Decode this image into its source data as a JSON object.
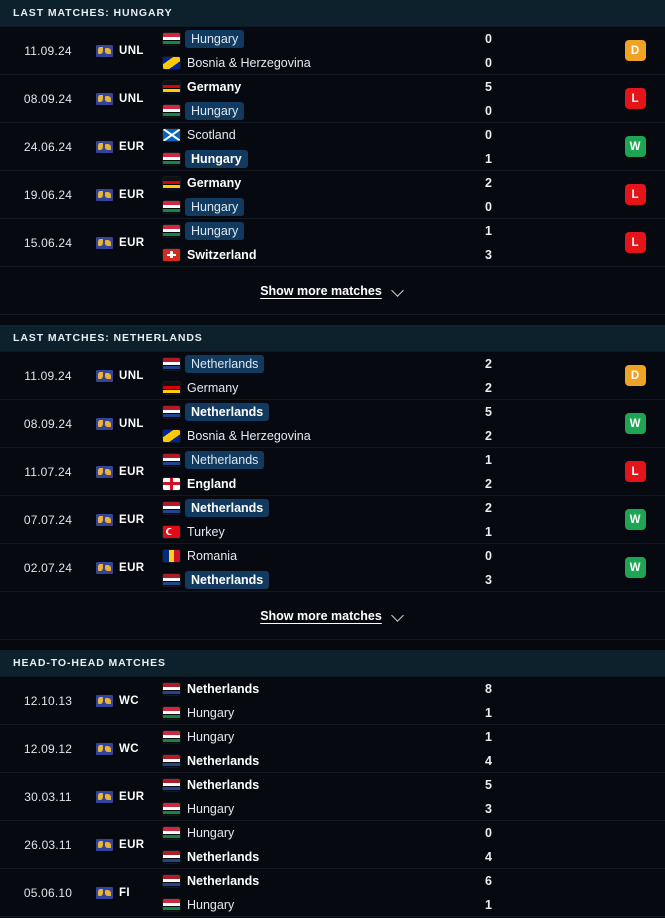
{
  "sections": [
    {
      "id": "last-matches-hungary",
      "title": "LAST MATCHES: HUNGARY",
      "show_more_label": "Show more matches",
      "matches": [
        {
          "date": "11.09.24",
          "competition": "UNL",
          "competition_icon": "globe-icon",
          "home": {
            "team": "Hungary",
            "flag": "hungary",
            "score": "0",
            "winner": false,
            "highlight": true
          },
          "away": {
            "team": "Bosnia & Herzegovina",
            "flag": "bosnia",
            "score": "0",
            "winner": false,
            "highlight": false
          },
          "result": "D"
        },
        {
          "date": "08.09.24",
          "competition": "UNL",
          "competition_icon": "globe-icon",
          "home": {
            "team": "Germany",
            "flag": "germany",
            "score": "5",
            "winner": true,
            "highlight": false
          },
          "away": {
            "team": "Hungary",
            "flag": "hungary",
            "score": "0",
            "winner": false,
            "highlight": true
          },
          "result": "L"
        },
        {
          "date": "24.06.24",
          "competition": "EUR",
          "competition_icon": "globe-icon",
          "home": {
            "team": "Scotland",
            "flag": "scotland",
            "score": "0",
            "winner": false,
            "highlight": false
          },
          "away": {
            "team": "Hungary",
            "flag": "hungary",
            "score": "1",
            "winner": true,
            "highlight": true
          },
          "result": "W"
        },
        {
          "date": "19.06.24",
          "competition": "EUR",
          "competition_icon": "globe-icon",
          "home": {
            "team": "Germany",
            "flag": "germany",
            "score": "2",
            "winner": true,
            "highlight": false
          },
          "away": {
            "team": "Hungary",
            "flag": "hungary",
            "score": "0",
            "winner": false,
            "highlight": true
          },
          "result": "L"
        },
        {
          "date": "15.06.24",
          "competition": "EUR",
          "competition_icon": "globe-icon",
          "home": {
            "team": "Hungary",
            "flag": "hungary",
            "score": "1",
            "winner": false,
            "highlight": true
          },
          "away": {
            "team": "Switzerland",
            "flag": "switzerland",
            "score": "3",
            "winner": true,
            "highlight": false
          },
          "result": "L"
        }
      ]
    },
    {
      "id": "last-matches-netherlands",
      "title": "LAST MATCHES: NETHERLANDS",
      "show_more_label": "Show more matches",
      "matches": [
        {
          "date": "11.09.24",
          "competition": "UNL",
          "competition_icon": "globe-icon",
          "home": {
            "team": "Netherlands",
            "flag": "netherlands",
            "score": "2",
            "winner": false,
            "highlight": true
          },
          "away": {
            "team": "Germany",
            "flag": "germany",
            "score": "2",
            "winner": false,
            "highlight": false
          },
          "result": "D"
        },
        {
          "date": "08.09.24",
          "competition": "UNL",
          "competition_icon": "globe-icon",
          "home": {
            "team": "Netherlands",
            "flag": "netherlands",
            "score": "5",
            "winner": true,
            "highlight": true
          },
          "away": {
            "team": "Bosnia & Herzegovina",
            "flag": "bosnia",
            "score": "2",
            "winner": false,
            "highlight": false
          },
          "result": "W"
        },
        {
          "date": "11.07.24",
          "competition": "EUR",
          "competition_icon": "globe-icon",
          "home": {
            "team": "Netherlands",
            "flag": "netherlands",
            "score": "1",
            "winner": false,
            "highlight": true
          },
          "away": {
            "team": "England",
            "flag": "england",
            "score": "2",
            "winner": true,
            "highlight": false
          },
          "result": "L"
        },
        {
          "date": "07.07.24",
          "competition": "EUR",
          "competition_icon": "globe-icon",
          "home": {
            "team": "Netherlands",
            "flag": "netherlands",
            "score": "2",
            "winner": true,
            "highlight": true
          },
          "away": {
            "team": "Turkey",
            "flag": "turkey",
            "score": "1",
            "winner": false,
            "highlight": false
          },
          "result": "W"
        },
        {
          "date": "02.07.24",
          "competition": "EUR",
          "competition_icon": "globe-icon",
          "home": {
            "team": "Romania",
            "flag": "romania",
            "score": "0",
            "winner": false,
            "highlight": false
          },
          "away": {
            "team": "Netherlands",
            "flag": "netherlands",
            "score": "3",
            "winner": true,
            "highlight": true
          },
          "result": "W"
        }
      ]
    },
    {
      "id": "head-to-head-matches",
      "title": "HEAD-TO-HEAD MATCHES",
      "show_more_label": null,
      "matches": [
        {
          "date": "12.10.13",
          "competition": "WC",
          "competition_icon": "globe-icon",
          "home": {
            "team": "Netherlands",
            "flag": "netherlands",
            "score": "8",
            "winner": true,
            "highlight": false
          },
          "away": {
            "team": "Hungary",
            "flag": "hungary",
            "score": "1",
            "winner": false,
            "highlight": false
          },
          "result": null
        },
        {
          "date": "12.09.12",
          "competition": "WC",
          "competition_icon": "globe-icon",
          "home": {
            "team": "Hungary",
            "flag": "hungary",
            "score": "1",
            "winner": false,
            "highlight": false
          },
          "away": {
            "team": "Netherlands",
            "flag": "netherlands",
            "score": "4",
            "winner": true,
            "highlight": false
          },
          "result": null
        },
        {
          "date": "30.03.11",
          "competition": "EUR",
          "competition_icon": "globe-icon",
          "home": {
            "team": "Netherlands",
            "flag": "netherlands",
            "score": "5",
            "winner": true,
            "highlight": false
          },
          "away": {
            "team": "Hungary",
            "flag": "hungary",
            "score": "3",
            "winner": false,
            "highlight": false
          },
          "result": null
        },
        {
          "date": "26.03.11",
          "competition": "EUR",
          "competition_icon": "globe-icon",
          "home": {
            "team": "Hungary",
            "flag": "hungary",
            "score": "0",
            "winner": false,
            "highlight": false
          },
          "away": {
            "team": "Netherlands",
            "flag": "netherlands",
            "score": "4",
            "winner": true,
            "highlight": false
          },
          "result": null
        },
        {
          "date": "05.06.10",
          "competition": "FI",
          "competition_icon": "globe-icon",
          "home": {
            "team": "Netherlands",
            "flag": "netherlands",
            "score": "6",
            "winner": true,
            "highlight": false
          },
          "away": {
            "team": "Hungary",
            "flag": "hungary",
            "score": "1",
            "winner": false,
            "highlight": false
          },
          "result": null
        }
      ]
    }
  ],
  "colors": {
    "win": "#1ea553",
    "loss": "#e4141b",
    "draw": "#f0a225",
    "header_bg": "#0c212b",
    "page_bg": "#05080d",
    "highlight_pill": "#123a5e"
  }
}
